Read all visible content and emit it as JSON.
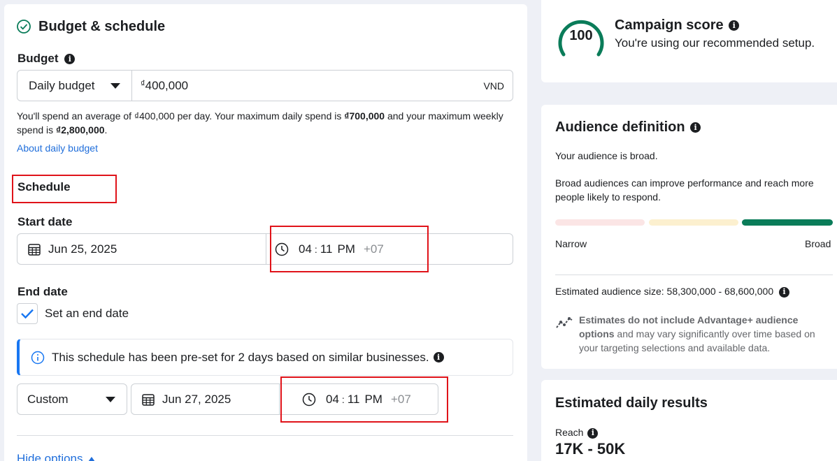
{
  "budget_schedule": {
    "title": "Budget & schedule",
    "budget_label": "Budget",
    "budget_type": "Daily budget",
    "currency_symbol": "₫",
    "budget_value": "400,000",
    "currency_code": "VND",
    "desc_part1": "You'll spend an average of ₫400,000 per day. Your maximum daily spend is ",
    "desc_bold1": "₫700,000",
    "desc_part2": " and your maximum weekly spend is ",
    "desc_bold2": "₫2,800,000",
    "desc_part3": ".",
    "about_link": "About daily budget",
    "schedule_label": "Schedule",
    "start_date_label": "Start date",
    "start_date": "Jun 25, 2025",
    "start_hour": "04",
    "start_minute": "11",
    "start_ampm": "PM",
    "start_tz": "+07",
    "end_date_label": "End date",
    "set_end_date_label": "Set an end date",
    "notice": "This schedule has been pre-set for 2 days based on similar businesses.",
    "end_mode": "Custom",
    "end_date": "Jun 27, 2025",
    "end_hour": "04",
    "end_minute": "11",
    "end_ampm": "PM",
    "end_tz": "+07",
    "hide_options": "Hide options"
  },
  "campaign_score": {
    "score": "100",
    "title": "Campaign score",
    "subtitle": "You're using our recommended setup.",
    "score_fraction": 1.0
  },
  "audience": {
    "title": "Audience definition",
    "broad_text": "Your audience is broad.",
    "broad_desc": "Broad audiences can improve performance and reach more people likely to respond.",
    "narrow_label": "Narrow",
    "broad_label": "Broad",
    "estimated_size_label": "Estimated audience size:",
    "estimated_size_value": "58,300,000 - 68,600,000",
    "estimate_note_bold": "Estimates do not include Advantage+ audience options",
    "estimate_note_rest": " and may vary significantly over time based on your targeting selections and available data."
  },
  "results": {
    "title": "Estimated daily results",
    "reach_label": "Reach",
    "reach_value": "17K - 50K"
  },
  "colors": {
    "accent_green": "#0a7c59",
    "link_blue": "#216fdb",
    "highlight_red": "#e0131a",
    "checkbox_blue": "#1877f2"
  }
}
